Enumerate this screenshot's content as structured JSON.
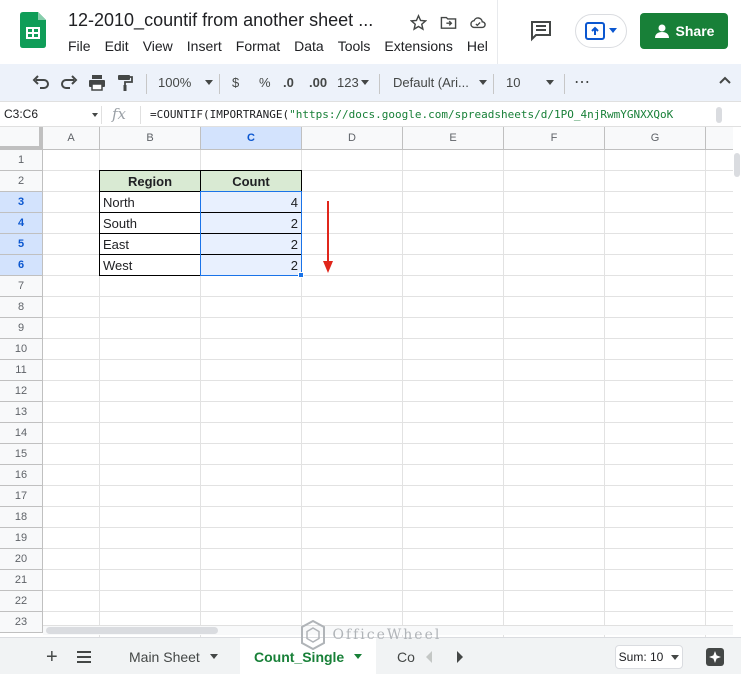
{
  "doc": {
    "title": "12-2010_countif from another sheet ..."
  },
  "menu": [
    "File",
    "Edit",
    "View",
    "Insert",
    "Format",
    "Data",
    "Tools",
    "Extensions",
    "Hel"
  ],
  "share": {
    "label": "Share"
  },
  "toolbar": {
    "zoom": "100%",
    "currency": "$",
    "percent": "%",
    "dec_less": ".0",
    "dec_more": ".00",
    "format_num": "123",
    "font": "Default (Ari...",
    "font_size": "10",
    "more": "⋯"
  },
  "formula_bar": {
    "name_box": "C3:C6",
    "fx": "fx",
    "formula_prefix": "=COUNTIF(IMPORTRANGE(",
    "formula_string": "\"https://docs.google.com/spreadsheets/d/1PO_4njRwmYGNXXQoK"
  },
  "columns": [
    "A",
    "B",
    "C",
    "D",
    "E",
    "F",
    "G"
  ],
  "rows": [
    "1",
    "2",
    "3",
    "4",
    "5",
    "6",
    "7",
    "8",
    "9",
    "10",
    "11",
    "12",
    "13",
    "14",
    "15",
    "16",
    "17",
    "18",
    "19",
    "20",
    "21",
    "22",
    "23"
  ],
  "table": {
    "headers": [
      "Region",
      "Count"
    ],
    "rows": [
      [
        "North",
        "4"
      ],
      [
        "South",
        "2"
      ],
      [
        "East",
        "2"
      ],
      [
        "West",
        "2"
      ]
    ]
  },
  "sheets": {
    "tabs": [
      "Main Sheet",
      "Count_Single",
      "Co"
    ],
    "active": "Count_Single"
  },
  "status": {
    "sum": "Sum: 10"
  },
  "watermark": "OfficeWheel",
  "colors": {
    "accent": "#188038",
    "selection": "#1a73e8",
    "header_fill": "#d9ead3",
    "arrow": "#e0261b"
  }
}
